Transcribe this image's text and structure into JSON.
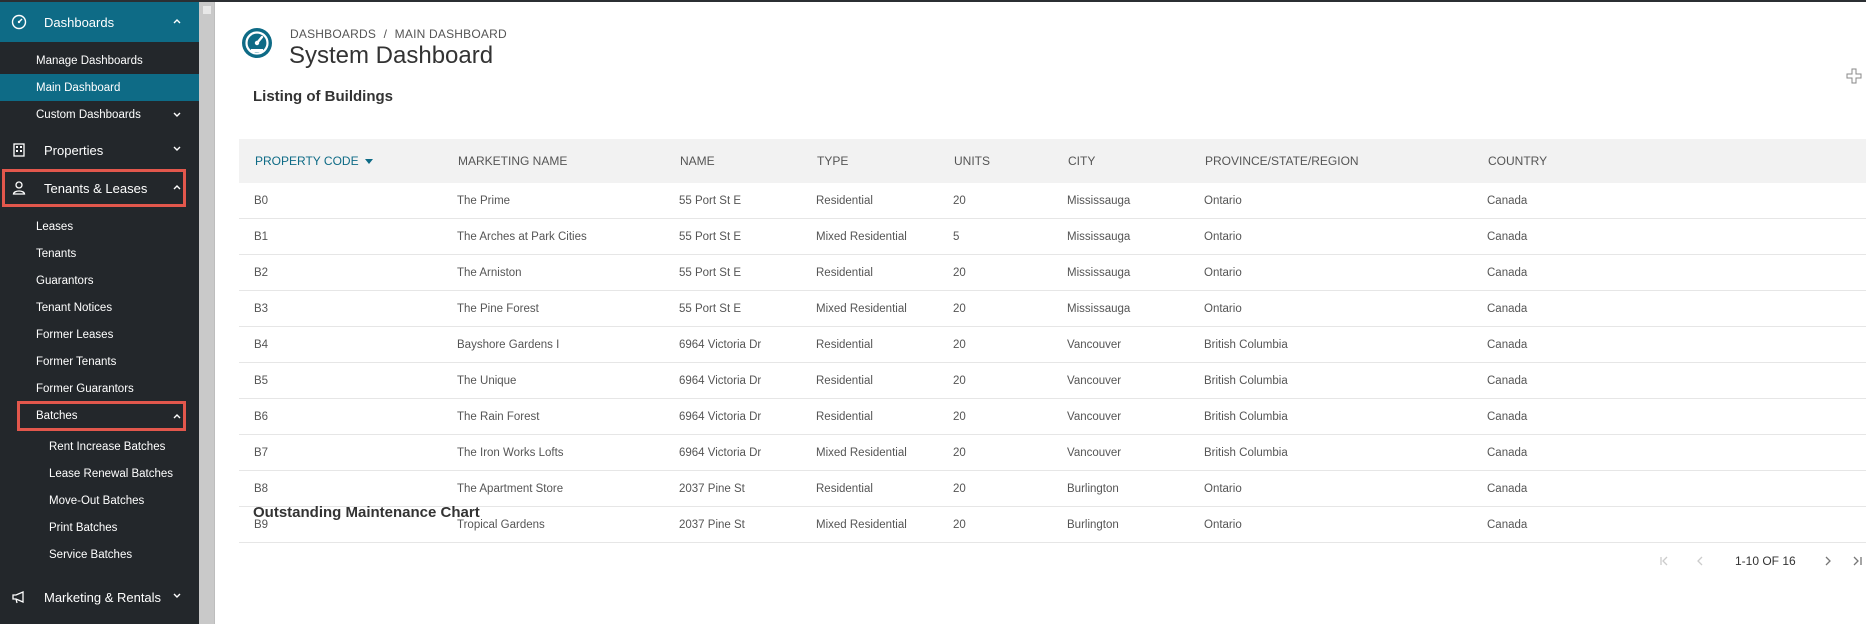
{
  "sidebar": {
    "sections": {
      "dashboards": {
        "label": "Dashboards",
        "icon": "dashboard-gauge-icon"
      },
      "properties": {
        "label": "Properties",
        "icon": "building-icon"
      },
      "tenants": {
        "label": "Tenants & Leases",
        "icon": "person-icon"
      },
      "marketing": {
        "label": "Marketing & Rentals",
        "icon": "megaphone-icon"
      }
    },
    "dashboard_items": [
      "Manage Dashboards",
      "Main Dashboard",
      "Custom Dashboards"
    ],
    "tenant_items": [
      "Leases",
      "Tenants",
      "Guarantors",
      "Tenant Notices",
      "Former Leases",
      "Former Tenants",
      "Former Guarantors",
      "Batches"
    ],
    "batch_items": [
      "Rent Increase Batches",
      "Lease Renewal Batches",
      "Move-Out Batches",
      "Print Batches",
      "Service Batches"
    ]
  },
  "header": {
    "breadcrumb": [
      "DASHBOARDS",
      "MAIN DASHBOARD"
    ],
    "breadcrumb_separator": "/",
    "title": "System Dashboard"
  },
  "buildings": {
    "title": "Listing of Buildings",
    "columns": [
      "PROPERTY CODE",
      "MARKETING NAME",
      "NAME",
      "TYPE",
      "UNITS",
      "CITY",
      "PROVINCE/STATE/REGION",
      "COUNTRY"
    ],
    "rows": [
      [
        "B0",
        "The Prime",
        "55 Port St E",
        "Residential",
        "20",
        "Mississauga",
        "Ontario",
        "Canada"
      ],
      [
        "B1",
        "The Arches at Park Cities",
        "55 Port St E",
        "Mixed Residential",
        "5",
        "Mississauga",
        "Ontario",
        "Canada"
      ],
      [
        "B2",
        "The Arniston",
        "55 Port St E",
        "Residential",
        "20",
        "Mississauga",
        "Ontario",
        "Canada"
      ],
      [
        "B3",
        "The Pine Forest",
        "55 Port St E",
        "Mixed Residential",
        "20",
        "Mississauga",
        "Ontario",
        "Canada"
      ],
      [
        "B4",
        "Bayshore Gardens I",
        "6964 Victoria Dr",
        "Residential",
        "20",
        "Vancouver",
        "British Columbia",
        "Canada"
      ],
      [
        "B5",
        "The Unique",
        "6964 Victoria Dr",
        "Residential",
        "20",
        "Vancouver",
        "British Columbia",
        "Canada"
      ],
      [
        "B6",
        "The Rain Forest",
        "6964 Victoria Dr",
        "Residential",
        "20",
        "Vancouver",
        "British Columbia",
        "Canada"
      ],
      [
        "B7",
        "The Iron Works Lofts",
        "6964 Victoria Dr",
        "Mixed Residential",
        "20",
        "Vancouver",
        "British Columbia",
        "Canada"
      ],
      [
        "B8",
        "The Apartment Store",
        "2037 Pine St",
        "Residential",
        "20",
        "Burlington",
        "Ontario",
        "Canada"
      ],
      [
        "B9",
        "Tropical Gardens",
        "2037 Pine St",
        "Mixed Residential",
        "20",
        "Burlington",
        "Ontario",
        "Canada"
      ]
    ],
    "pagination": "1-10 OF 16"
  },
  "maintenance": {
    "title": "Outstanding Maintenance Chart"
  },
  "colors": {
    "sidebar_bg": "#23272b",
    "accent": "#0e6b86",
    "highlight_box": "#e2574c"
  }
}
